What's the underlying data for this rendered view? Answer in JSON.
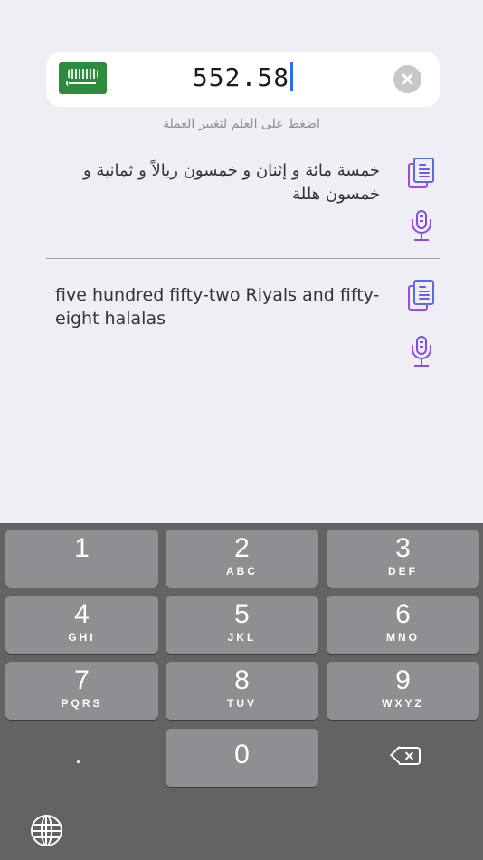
{
  "amount_input": {
    "value": "552.58",
    "currency_flag": "saudi-arabia-flag"
  },
  "hint_text": "اضغط على العلم لتغيير العملة",
  "results": {
    "arabic": {
      "text": "خمسة مائة و إثنان و خمسون ريالاً و ثمانية و خمسون هللة"
    },
    "english": {
      "text": "five hundred fifty-two Riyals and fifty-eight halalas"
    },
    "icons": [
      "copy-document-icon",
      "microphone-icon"
    ],
    "icon_colors": {
      "purple": "#a04ae0",
      "blue": "#5a6ae8"
    }
  },
  "keyboard": {
    "keys": [
      {
        "num": "1",
        "letters": ""
      },
      {
        "num": "2",
        "letters": "ABC"
      },
      {
        "num": "3",
        "letters": "DEF"
      },
      {
        "num": "4",
        "letters": "GHI"
      },
      {
        "num": "5",
        "letters": "JKL"
      },
      {
        "num": "6",
        "letters": "MNO"
      },
      {
        "num": "7",
        "letters": "PQRS"
      },
      {
        "num": "8",
        "letters": "TUV"
      },
      {
        "num": "9",
        "letters": "WXYZ"
      }
    ],
    "decimal": ".",
    "zero": "0",
    "backspace_icon": "backspace-icon",
    "globe_icon": "globe-icon"
  }
}
